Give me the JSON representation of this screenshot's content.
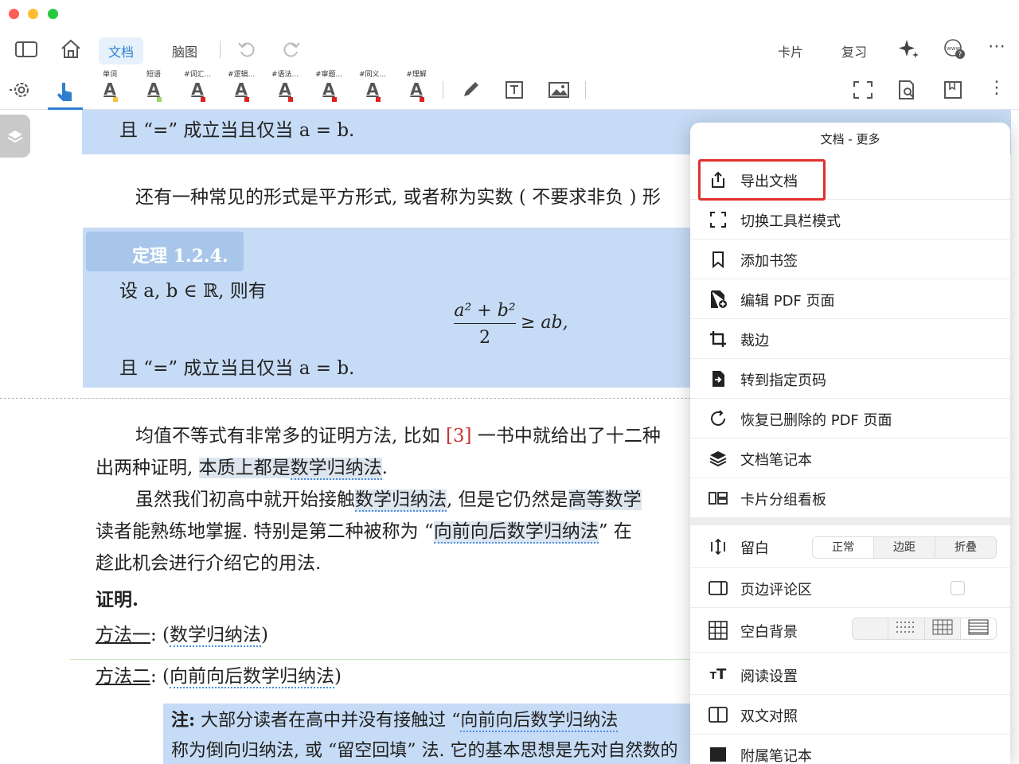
{
  "colors": {
    "accent": "#2f7fd1",
    "theorem_bg": "#c6dbf5",
    "highlight_red": "#e0312f"
  },
  "toolbar": {
    "tabs": [
      {
        "label": "文档",
        "active": true
      },
      {
        "label": "脑图",
        "active": false
      }
    ],
    "right": {
      "cards": "卡片",
      "review": "复习"
    }
  },
  "highlight_tools": [
    {
      "label": "单词",
      "color": "#f5c242"
    },
    {
      "label": "短语",
      "color": "#9ed36a"
    },
    {
      "label": "#词汇...",
      "color": "#e02020"
    },
    {
      "label": "#逻辑...",
      "color": "#e02020"
    },
    {
      "label": "#语法...",
      "color": "#e02020"
    },
    {
      "label": "#审题...",
      "color": "#e02020"
    },
    {
      "label": "#同义...",
      "color": "#e02020"
    },
    {
      "label": "#理解",
      "color": "#e02020"
    }
  ],
  "document": {
    "top_line": "且 “=” 成立当且仅当 a = b.",
    "para_square": "还有一种常见的形式是平方形式, 或者称为实数 ( 不要求非负 ) 形",
    "theorem": {
      "title": "定理 1.2.4.",
      "line1": "设 a, b ∈ ℝ, 则有",
      "formula_num": "a² + b²",
      "formula_den": "2",
      "formula_rest": "≥ ab,",
      "line2": "且 “=” 成立当且仅当 a = b."
    },
    "p1_a": "均值不等式有非常多的证明方法, 比如 ",
    "p1_cite": "[3]",
    "p1_b": " 一书中就给出了十二种",
    "p2_a": "出两种证明, ",
    "p2_hl": "本质上都是",
    "p2_dot": "数学归纳法",
    "p2_end": ".",
    "p3_a": "虽然我们初高中就开始接触",
    "p3_dot": "数学归纳法",
    "p3_b": ", 但是它仍然是",
    "p3_hl": "高等数学",
    "p4_a": "读者能熟练地掌握. 特别是第二种被称为 “",
    "p4_dot": "向前向后数学归纳法",
    "p4_b": "” 在",
    "p5": "趁此机会进行介绍它的用法.",
    "proof": "证明.",
    "m1_label": "方法一",
    "m1_colon": ": (",
    "m1_dot": "数学归纳法",
    "m1_end": ")",
    "m2_label": "方法二",
    "m2_colon": ": (",
    "m2_dot": "向前向后数学归纳法",
    "m2_end": ")",
    "note_label": "注:",
    "note_a": " 大部分读者在高中并没有接触过 “",
    "note_dot": "向前向后数学归纳法",
    "note_line2": "称为倒向归纳法, 或 “留空回填” 法. 它的基本思想是先对自然数的"
  },
  "popover": {
    "title": "文档 - 更多",
    "items": [
      {
        "icon": "share-export-icon",
        "label": "导出文档"
      },
      {
        "icon": "expand-icon",
        "label": "切换工具栏模式"
      },
      {
        "icon": "bookmark-icon",
        "label": "添加书签"
      },
      {
        "icon": "file-add-icon",
        "label": "编辑 PDF 页面"
      },
      {
        "icon": "crop-icon",
        "label": "裁边"
      },
      {
        "icon": "goto-page-icon",
        "label": "转到指定页码"
      },
      {
        "icon": "restore-icon",
        "label": "恢复已删除的 PDF 页面"
      },
      {
        "icon": "layers-icon",
        "label": "文档笔记本"
      },
      {
        "icon": "card-board-icon",
        "label": "卡片分组看板"
      }
    ],
    "margin": {
      "label": "留白",
      "options": [
        "正常",
        "边距",
        "折叠"
      ],
      "selected": "正常"
    },
    "comment_area": {
      "label": "页边评论区",
      "checked": false
    },
    "background": {
      "label": "空白背景"
    },
    "reading": {
      "label": "阅读设置"
    },
    "dual": {
      "label": "双文对照"
    },
    "last_partial": {
      "label": "附属笔记本"
    }
  }
}
